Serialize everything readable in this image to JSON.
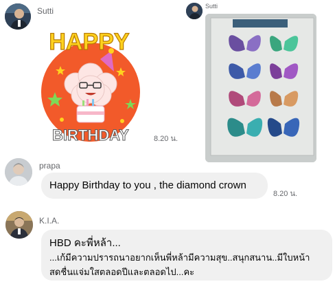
{
  "messages": {
    "first": {
      "sender": "Sutti",
      "sticker_text_top": "HAPPY",
      "sticker_text_bottom": "BIRTHDAY",
      "time": "8.20 น."
    },
    "photo": {
      "sender": "Sutti"
    },
    "prapa": {
      "sender": "prapa",
      "text": "Happy Birthday to you , the diamond crown",
      "time": "8.20 น."
    },
    "kia": {
      "sender": "K.I.A.",
      "line1": "HBD คะพี่หล้า...",
      "line2": "...เก้มีความปรารถนาอยากเห็นพี่หล้ามีความสุข..สนุกสนาน..มีใบหน้า",
      "line3": "สดชื่นแจ่มใสตลอดปีและตลอดไป...คะ"
    }
  },
  "colors": {
    "bubble": "#f0f0f0",
    "meta_text": "#65676b",
    "sticker_bg": "#f25a2a"
  }
}
